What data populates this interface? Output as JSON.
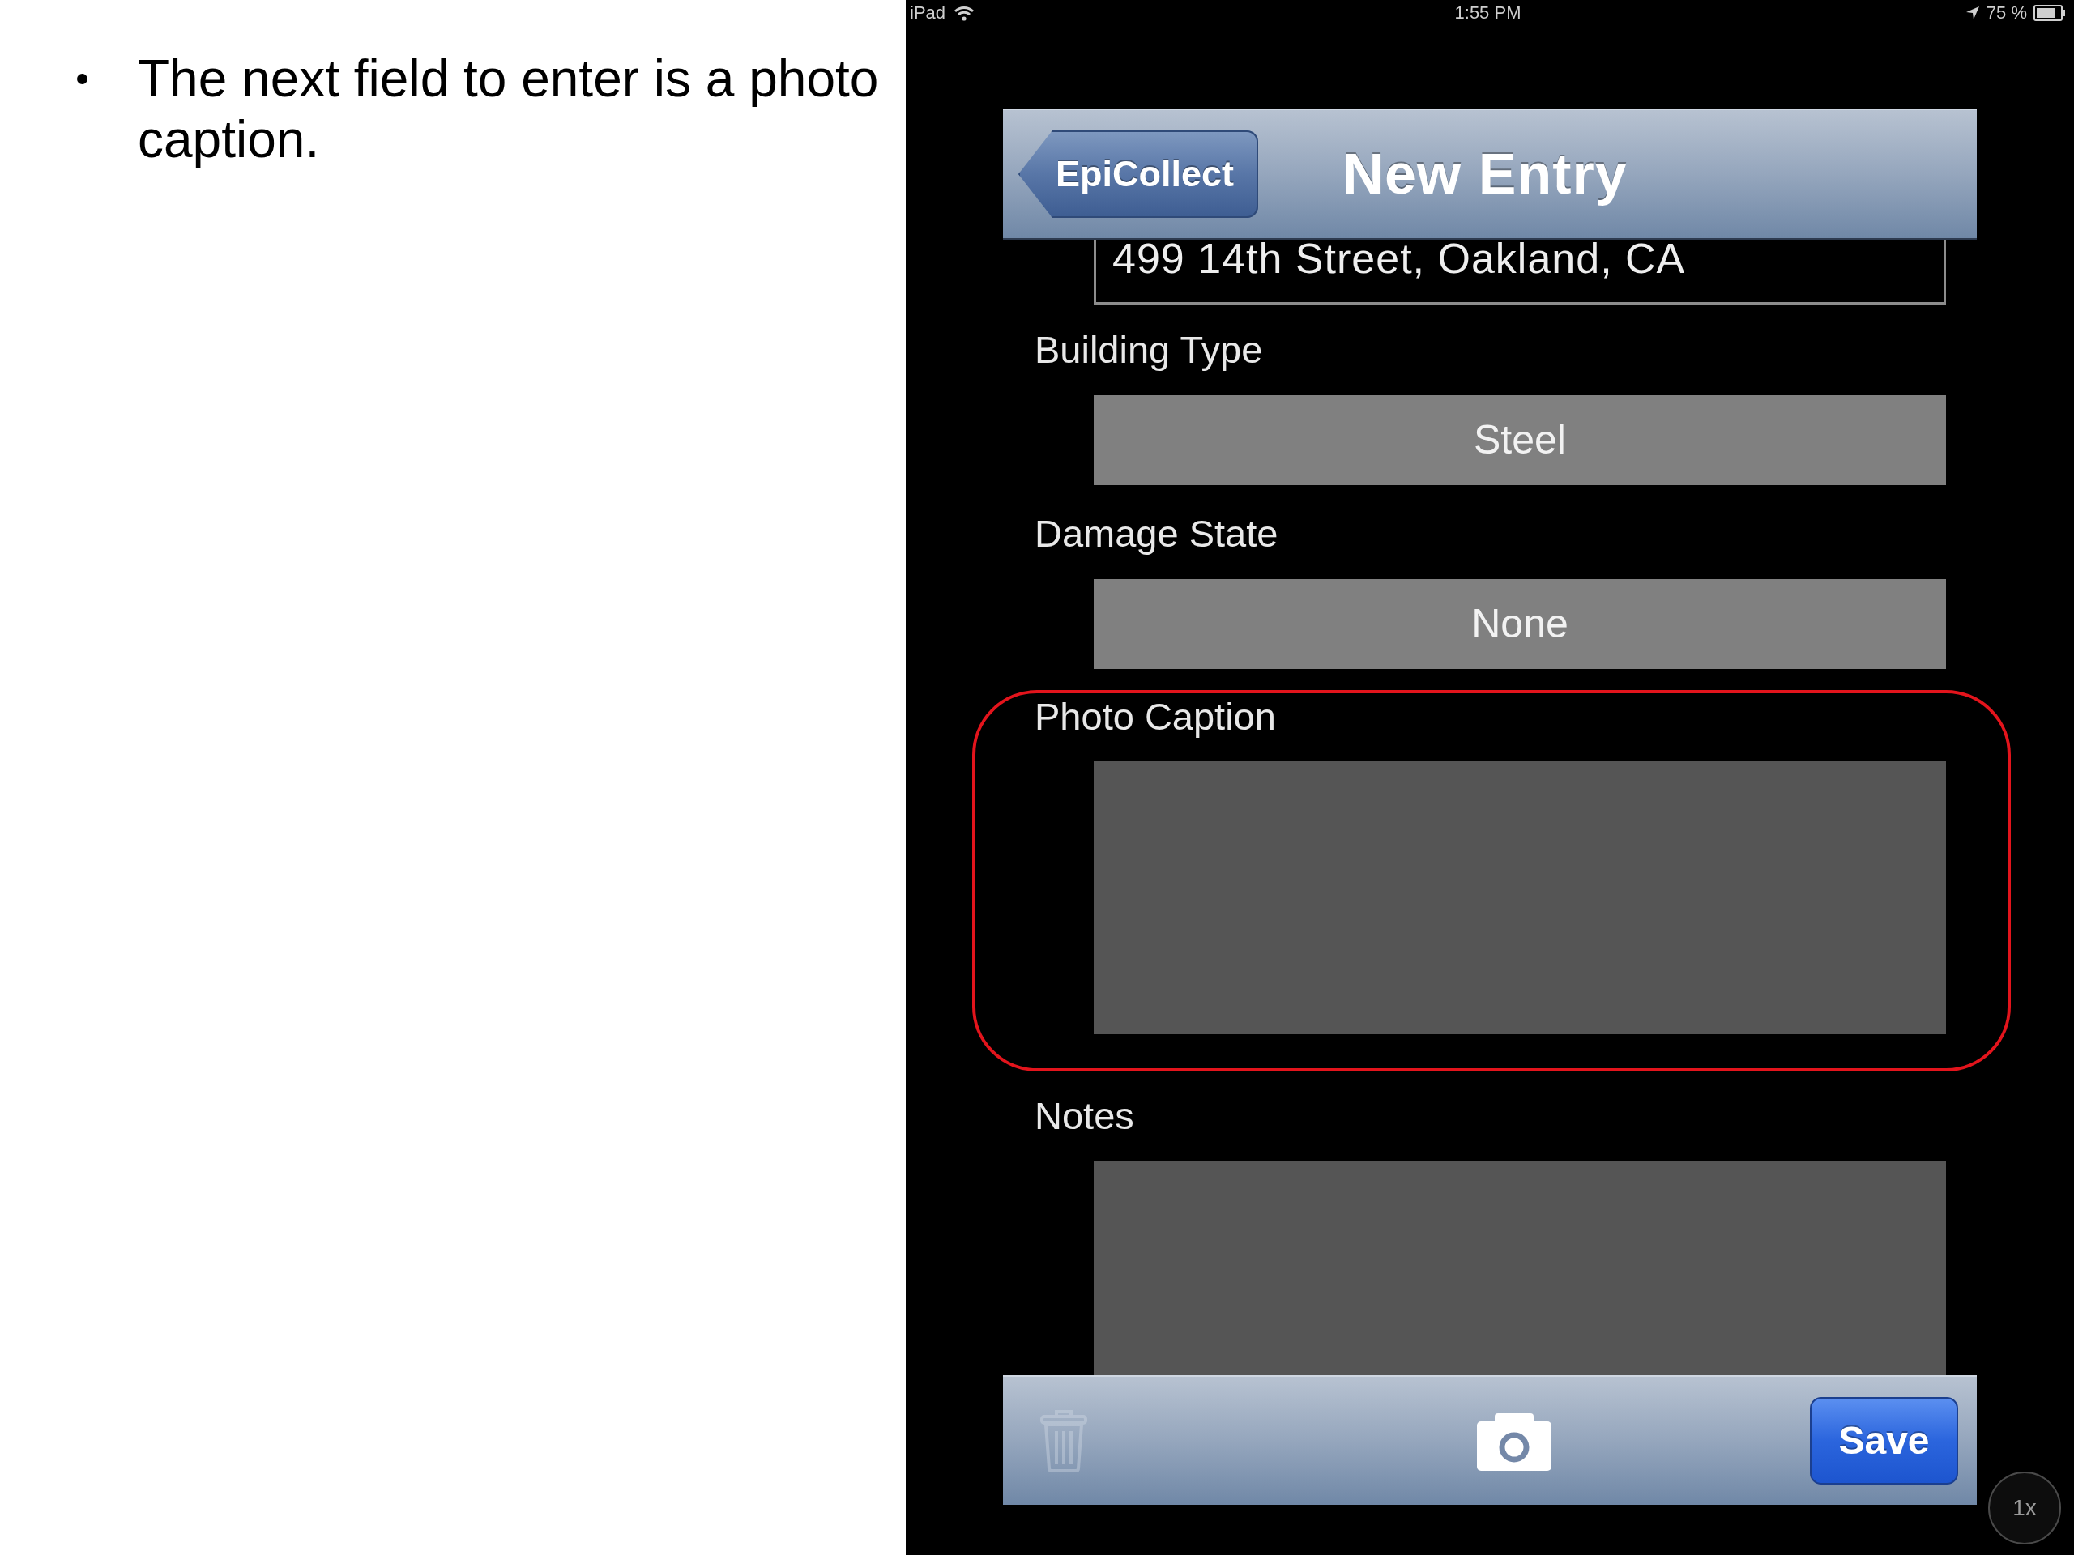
{
  "slide": {
    "bullets": [
      "The next field to enter is a photo caption."
    ]
  },
  "status_bar": {
    "device": "iPad",
    "time": "1:55 PM",
    "battery": "75 %"
  },
  "nav_bar": {
    "back_button": "EpiCollect",
    "title": "New Entry"
  },
  "fields": [
    {
      "kind": "text",
      "value": "499 14th Street, Oakland, CA",
      "highlighted": false
    },
    {
      "kind": "select",
      "label": "Building Type",
      "value": "Steel",
      "highlighted": false
    },
    {
      "kind": "select",
      "label": "Damage State",
      "value": "None",
      "highlighted": false
    },
    {
      "kind": "textarea",
      "label": "Photo Caption",
      "highlighted": true
    },
    {
      "kind": "textarea",
      "label": "Notes",
      "highlighted": false
    }
  ],
  "toolbar": {
    "trash_button": {
      "disabled": true
    },
    "save_button": "Save"
  },
  "zoom_button": "1x"
}
